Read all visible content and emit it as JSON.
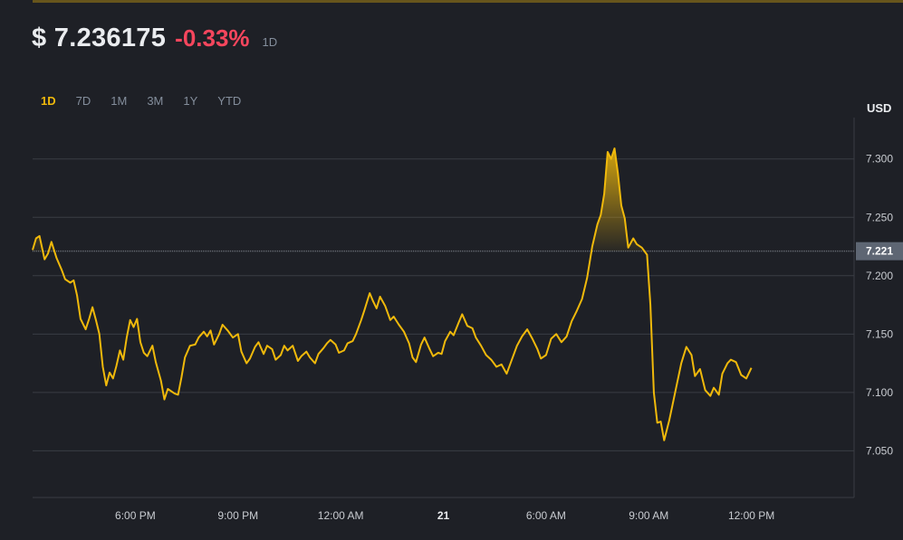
{
  "header": {
    "price": "$ 7.236175",
    "change": "-0.33%",
    "period": "1D"
  },
  "tabs": [
    "1D",
    "7D",
    "1M",
    "3M",
    "1Y",
    "YTD"
  ],
  "active_tab": "1D",
  "colors": {
    "background": "#1e2026",
    "line": "#f0b90b",
    "negative": "#f6465d",
    "grid": "#3a3d44",
    "muted": "#848e9c"
  },
  "chart_data": {
    "type": "area",
    "currency_label": "USD",
    "y_ticks": [
      "7.300",
      "7.250",
      "7.200",
      "7.150",
      "7.100",
      "7.050"
    ],
    "y_tick_values": [
      7.3,
      7.25,
      7.2,
      7.15,
      7.1,
      7.05
    ],
    "ylim": [
      7.01,
      7.33
    ],
    "reference_value": 7.221,
    "reference_label": "7.221",
    "x_ticks": [
      {
        "label": "6:00 PM",
        "x": 1.0
      },
      {
        "label": "9:00 PM",
        "x": 4.0
      },
      {
        "label": "12:00 AM",
        "x": 7.0
      },
      {
        "label": "21",
        "x": 10.0,
        "bold": true
      },
      {
        "label": "6:00 AM",
        "x": 13.0
      },
      {
        "label": "9:00 AM",
        "x": 16.0
      },
      {
        "label": "12:00 PM",
        "x": 19.0
      }
    ],
    "xlim": [
      -2.0,
      22.0
    ],
    "grid": true,
    "series": [
      {
        "values": [
          [
            -2.0,
            7.222
          ],
          [
            -1.9,
            7.232
          ],
          [
            -1.8,
            7.234
          ],
          [
            -1.65,
            7.214
          ],
          [
            -1.55,
            7.219
          ],
          [
            -1.45,
            7.229
          ],
          [
            -1.3,
            7.215
          ],
          [
            -1.15,
            7.205
          ],
          [
            -1.05,
            7.197
          ],
          [
            -0.9,
            7.194
          ],
          [
            -0.8,
            7.196
          ],
          [
            -0.7,
            7.183
          ],
          [
            -0.6,
            7.163
          ],
          [
            -0.45,
            7.154
          ],
          [
            -0.35,
            7.163
          ],
          [
            -0.25,
            7.173
          ],
          [
            -0.15,
            7.162
          ],
          [
            -0.05,
            7.15
          ],
          [
            0.05,
            7.122
          ],
          [
            0.15,
            7.106
          ],
          [
            0.25,
            7.117
          ],
          [
            0.35,
            7.112
          ],
          [
            0.45,
            7.123
          ],
          [
            0.55,
            7.136
          ],
          [
            0.65,
            7.128
          ],
          [
            0.75,
            7.147
          ],
          [
            0.85,
            7.162
          ],
          [
            0.95,
            7.156
          ],
          [
            1.05,
            7.163
          ],
          [
            1.15,
            7.143
          ],
          [
            1.25,
            7.134
          ],
          [
            1.35,
            7.131
          ],
          [
            1.5,
            7.14
          ],
          [
            1.6,
            7.126
          ],
          [
            1.75,
            7.11
          ],
          [
            1.85,
            7.094
          ],
          [
            1.95,
            7.103
          ],
          [
            2.15,
            7.099
          ],
          [
            2.25,
            7.098
          ],
          [
            2.35,
            7.113
          ],
          [
            2.45,
            7.13
          ],
          [
            2.6,
            7.14
          ],
          [
            2.75,
            7.141
          ],
          [
            2.85,
            7.147
          ],
          [
            3.0,
            7.152
          ],
          [
            3.1,
            7.148
          ],
          [
            3.2,
            7.153
          ],
          [
            3.3,
            7.141
          ],
          [
            3.45,
            7.15
          ],
          [
            3.55,
            7.158
          ],
          [
            3.7,
            7.153
          ],
          [
            3.85,
            7.147
          ],
          [
            4.0,
            7.15
          ],
          [
            4.1,
            7.135
          ],
          [
            4.25,
            7.125
          ],
          [
            4.35,
            7.129
          ],
          [
            4.5,
            7.139
          ],
          [
            4.6,
            7.143
          ],
          [
            4.75,
            7.133
          ],
          [
            4.85,
            7.14
          ],
          [
            5.0,
            7.137
          ],
          [
            5.1,
            7.128
          ],
          [
            5.25,
            7.132
          ],
          [
            5.35,
            7.14
          ],
          [
            5.45,
            7.136
          ],
          [
            5.6,
            7.14
          ],
          [
            5.75,
            7.127
          ],
          [
            5.85,
            7.131
          ],
          [
            6.0,
            7.135
          ],
          [
            6.1,
            7.13
          ],
          [
            6.25,
            7.125
          ],
          [
            6.35,
            7.133
          ],
          [
            6.5,
            7.138
          ],
          [
            6.6,
            7.142
          ],
          [
            6.7,
            7.145
          ],
          [
            6.85,
            7.141
          ],
          [
            6.95,
            7.134
          ],
          [
            7.1,
            7.136
          ],
          [
            7.2,
            7.142
          ],
          [
            7.35,
            7.144
          ],
          [
            7.45,
            7.15
          ],
          [
            7.6,
            7.162
          ],
          [
            7.7,
            7.171
          ],
          [
            7.85,
            7.185
          ],
          [
            7.95,
            7.178
          ],
          [
            8.05,
            7.172
          ],
          [
            8.15,
            7.182
          ],
          [
            8.3,
            7.174
          ],
          [
            8.45,
            7.162
          ],
          [
            8.55,
            7.165
          ],
          [
            8.7,
            7.158
          ],
          [
            8.85,
            7.152
          ],
          [
            9.0,
            7.142
          ],
          [
            9.1,
            7.13
          ],
          [
            9.2,
            7.126
          ],
          [
            9.35,
            7.141
          ],
          [
            9.45,
            7.147
          ],
          [
            9.6,
            7.137
          ],
          [
            9.7,
            7.131
          ],
          [
            9.85,
            7.134
          ],
          [
            9.95,
            7.133
          ],
          [
            10.05,
            7.144
          ],
          [
            10.2,
            7.152
          ],
          [
            10.3,
            7.149
          ],
          [
            10.45,
            7.16
          ],
          [
            10.55,
            7.167
          ],
          [
            10.7,
            7.157
          ],
          [
            10.85,
            7.155
          ],
          [
            10.95,
            7.147
          ],
          [
            11.1,
            7.14
          ],
          [
            11.25,
            7.132
          ],
          [
            11.4,
            7.128
          ],
          [
            11.55,
            7.122
          ],
          [
            11.7,
            7.124
          ],
          [
            11.85,
            7.116
          ],
          [
            12.0,
            7.128
          ],
          [
            12.15,
            7.14
          ],
          [
            12.3,
            7.148
          ],
          [
            12.45,
            7.154
          ],
          [
            12.6,
            7.146
          ],
          [
            12.75,
            7.137
          ],
          [
            12.85,
            7.129
          ],
          [
            13.0,
            7.132
          ],
          [
            13.15,
            7.146
          ],
          [
            13.3,
            7.15
          ],
          [
            13.45,
            7.143
          ],
          [
            13.6,
            7.148
          ],
          [
            13.75,
            7.161
          ],
          [
            13.9,
            7.17
          ],
          [
            14.05,
            7.18
          ],
          [
            14.2,
            7.198
          ],
          [
            14.35,
            7.225
          ],
          [
            14.5,
            7.244
          ],
          [
            14.6,
            7.252
          ],
          [
            14.7,
            7.27
          ],
          [
            14.8,
            7.306
          ],
          [
            14.9,
            7.3
          ],
          [
            15.0,
            7.309
          ],
          [
            15.1,
            7.288
          ],
          [
            15.2,
            7.26
          ],
          [
            15.3,
            7.249
          ],
          [
            15.4,
            7.224
          ],
          [
            15.55,
            7.232
          ],
          [
            15.65,
            7.227
          ],
          [
            15.8,
            7.224
          ],
          [
            15.95,
            7.218
          ],
          [
            16.05,
            7.175
          ],
          [
            16.15,
            7.1
          ],
          [
            16.25,
            7.074
          ],
          [
            16.35,
            7.075
          ],
          [
            16.45,
            7.059
          ],
          [
            16.6,
            7.076
          ],
          [
            16.7,
            7.09
          ],
          [
            16.8,
            7.104
          ],
          [
            16.95,
            7.125
          ],
          [
            17.1,
            7.139
          ],
          [
            17.25,
            7.132
          ],
          [
            17.35,
            7.114
          ],
          [
            17.5,
            7.12
          ],
          [
            17.65,
            7.102
          ],
          [
            17.8,
            7.097
          ],
          [
            17.9,
            7.104
          ],
          [
            18.05,
            7.098
          ],
          [
            18.15,
            7.116
          ],
          [
            18.3,
            7.125
          ],
          [
            18.4,
            7.128
          ],
          [
            18.55,
            7.126
          ],
          [
            18.7,
            7.115
          ],
          [
            18.85,
            7.112
          ],
          [
            19.0,
            7.121
          ]
        ]
      }
    ]
  }
}
